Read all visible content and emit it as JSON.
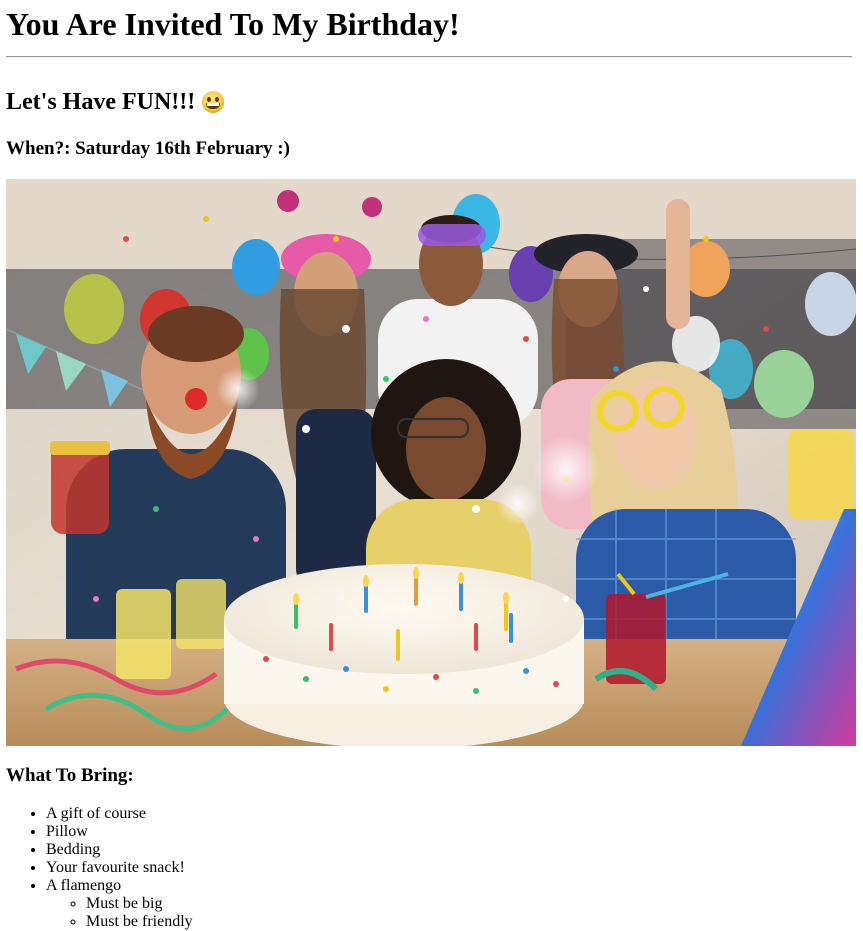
{
  "header": {
    "title": "You Are Invited To My Birthday!"
  },
  "tagline": {
    "text": "Let's Have FUN!!!",
    "emoji_icon": "grinning-face-icon"
  },
  "when": {
    "text": "When?: Saturday 16th February :)"
  },
  "photo": {
    "alt": "Friends celebrating a birthday with a cake, balloons and confetti"
  },
  "bring": {
    "heading": "What To Bring:",
    "items": [
      "A gift of course",
      "Pillow",
      "Bedding",
      "Your favourite snack!",
      "A flamengo"
    ],
    "flamengo_details": [
      "Must be big",
      "Must be friendly"
    ]
  },
  "colors": {
    "text": "#000000",
    "background": "#ffffff",
    "rule": "#9a9a9a",
    "photo_wall": "#d8cfc4",
    "photo_table": "#c9a57a"
  }
}
